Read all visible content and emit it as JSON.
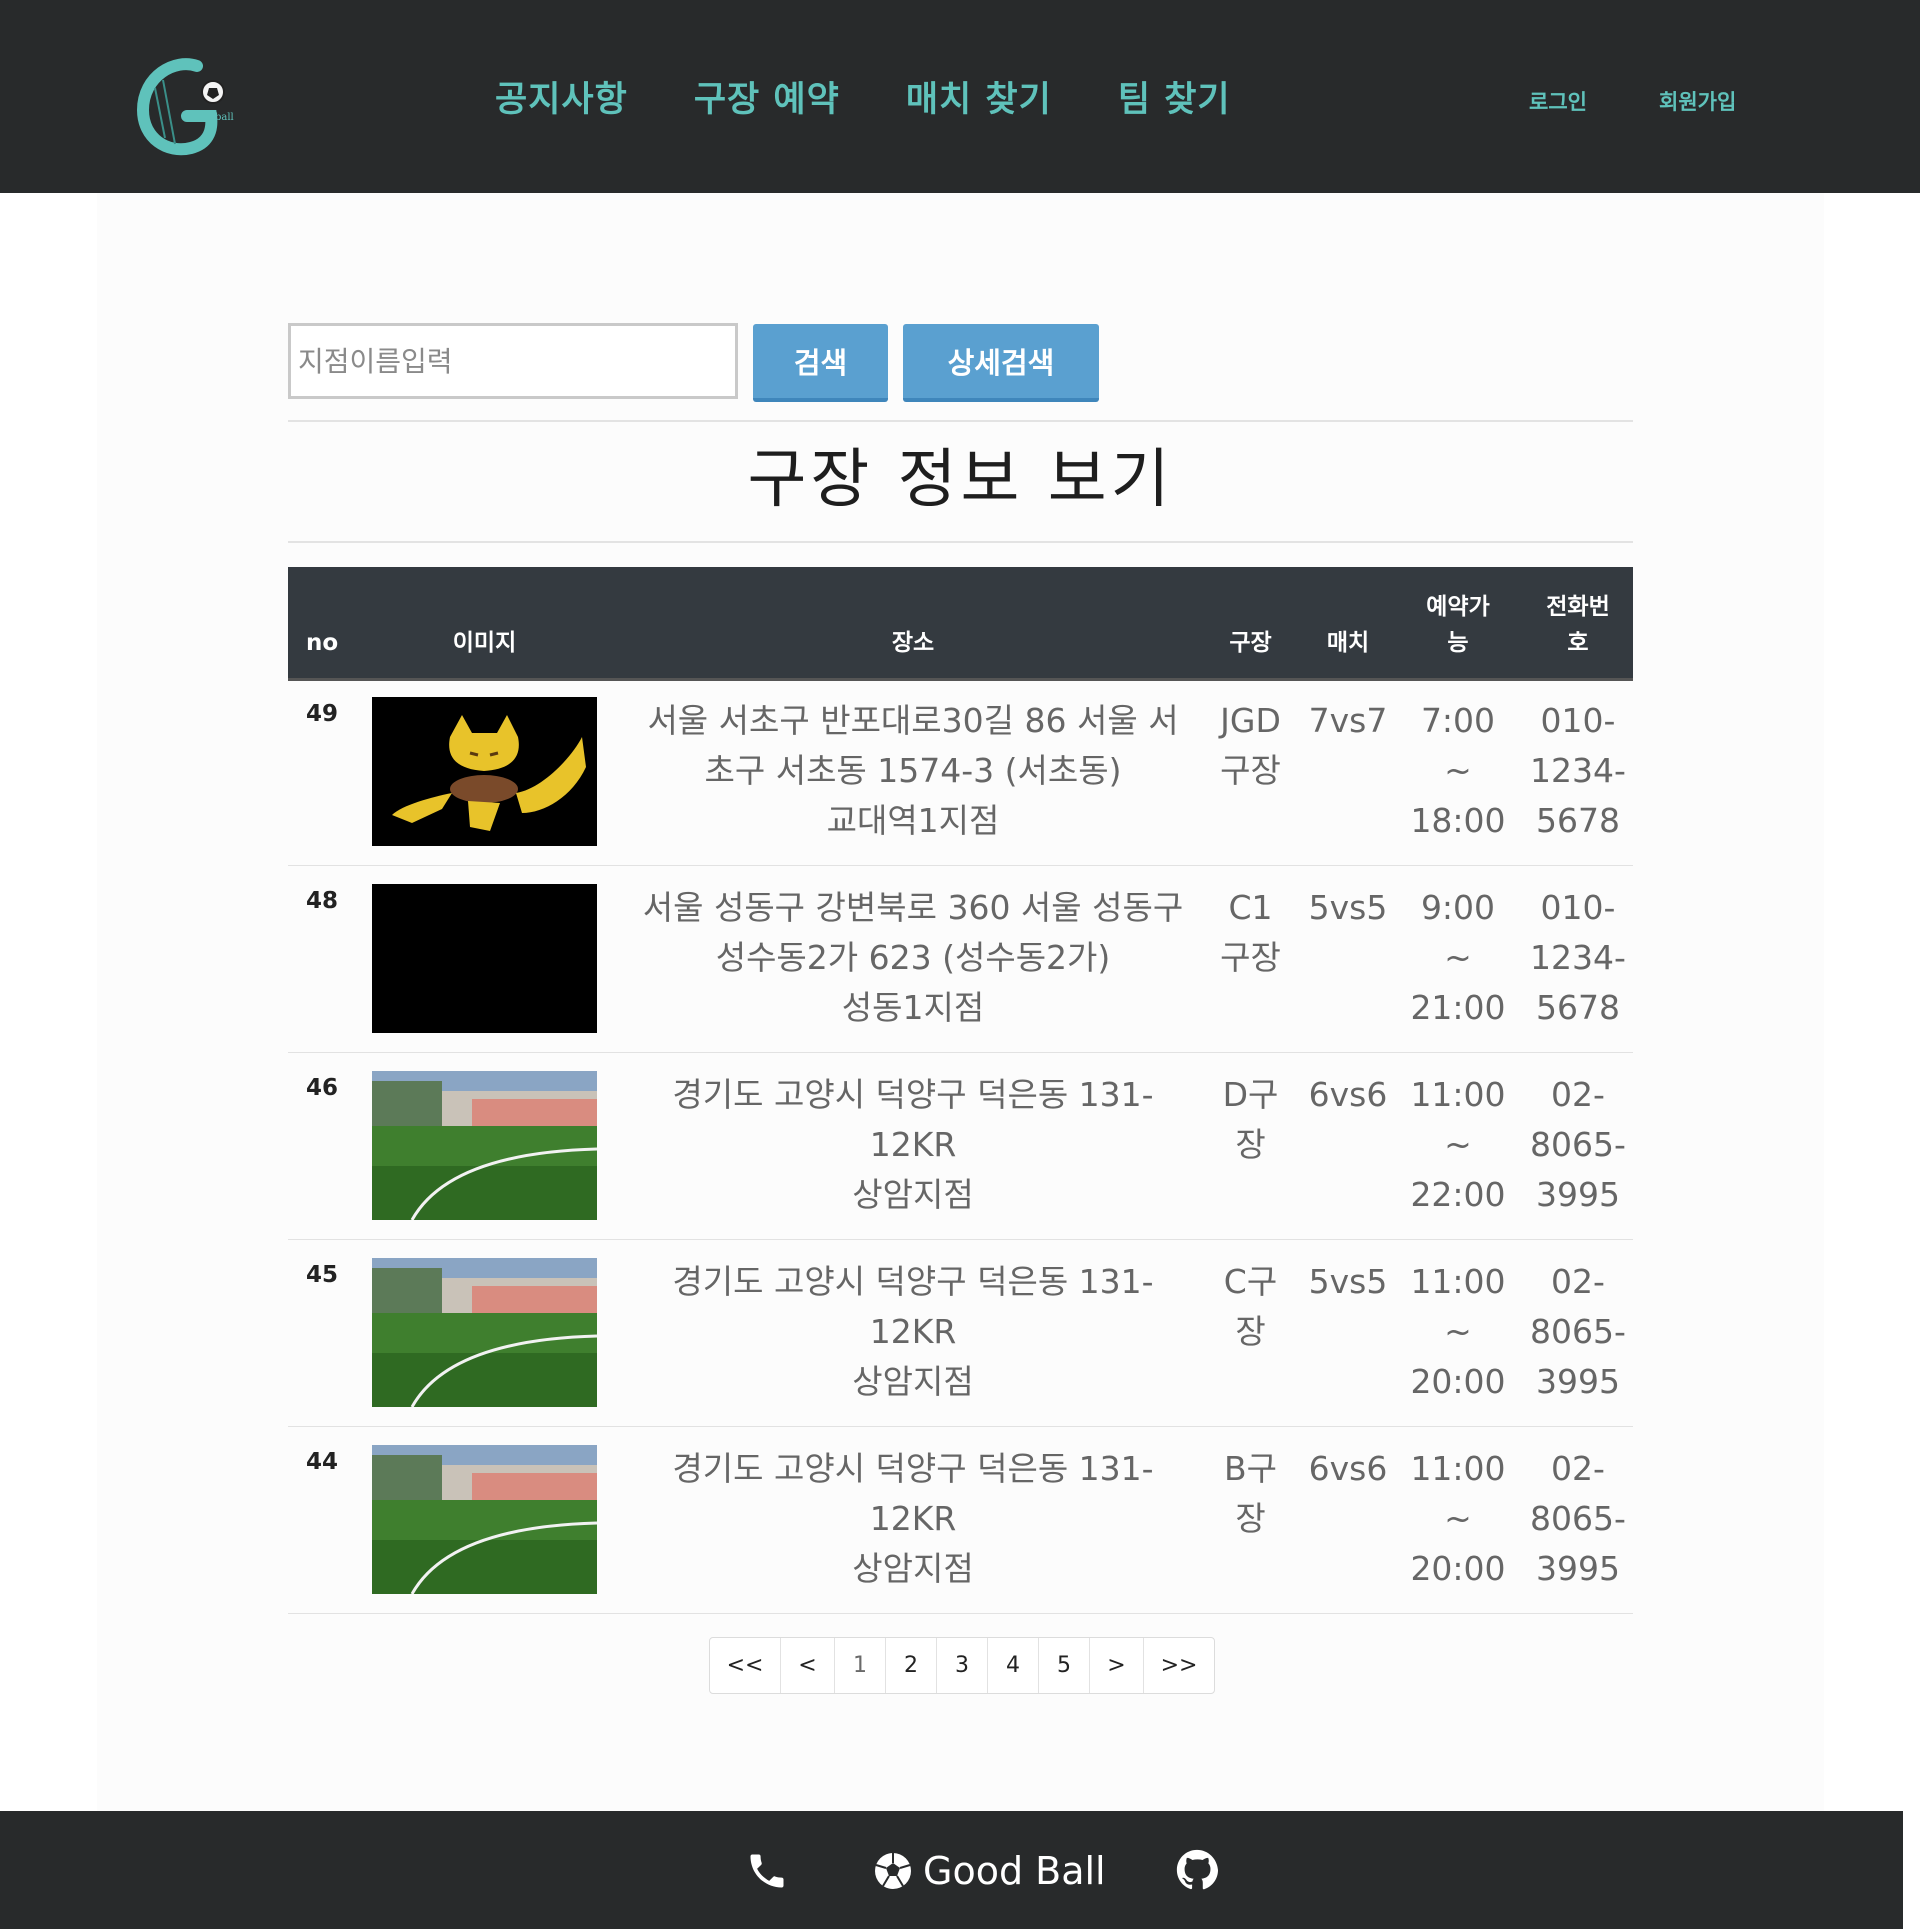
{
  "nav": {
    "items": [
      "공지사항",
      "구장 예약",
      "매치 찾기",
      "팀 찾기"
    ],
    "login": "로그인",
    "signup": "회원가입"
  },
  "search": {
    "placeholder": "지점이름입력",
    "value": "",
    "search_label": "검색",
    "advanced_label": "상세검색"
  },
  "page_title": "구장 정보 보기",
  "table": {
    "headers": [
      "no",
      "이미지",
      "장소",
      "구장",
      "매치",
      "예약가\n능",
      "전화번\n호"
    ],
    "rows": [
      {
        "no": "49",
        "image": "abra",
        "place": "서울 서초구 반포대로30길 86 서울 서초구 서초동 1574-3 (서초동)",
        "branch": "교대역1지점",
        "field": "JGD구장",
        "match": "7vs7",
        "time": "7:00\n~\n18:00",
        "phone": "010-\n1234-\n5678"
      },
      {
        "no": "48",
        "image": "black",
        "place": "서울 성동구 강변북로 360 서울 성동구 성수동2가 623 (성수동2가)",
        "branch": "성동1지점",
        "field": "C1구장",
        "match": "5vs5",
        "time": "9:00\n~\n21:00",
        "phone": "010-\n1234-\n5678"
      },
      {
        "no": "46",
        "image": "turf",
        "place": "경기도 고양시 덕양구 덕은동 131-12KR",
        "branch": "상암지점",
        "field": "D구장",
        "match": "6vs6",
        "time": "11:00\n~\n22:00",
        "phone": "02-\n8065-\n3995"
      },
      {
        "no": "45",
        "image": "turf",
        "place": "경기도 고양시 덕양구 덕은동 131-12KR",
        "branch": "상암지점",
        "field": "C구장",
        "match": "5vs5",
        "time": "11:00\n~\n20:00",
        "phone": "02-\n8065-\n3995"
      },
      {
        "no": "44",
        "image": "turf",
        "place": "경기도 고양시 덕양구 덕은동 131-12KR",
        "branch": "상암지점",
        "field": "B구장",
        "match": "6vs6",
        "time": "11:00\n~\n20:00",
        "phone": "02-\n8065-\n3995"
      }
    ]
  },
  "pagination": {
    "items": [
      "<<",
      "<",
      "1",
      "2",
      "3",
      "4",
      "5",
      ">",
      ">>"
    ],
    "current": "1"
  },
  "footer": {
    "brand": "Good Ball"
  },
  "colors": {
    "header_bg": "#282a2b",
    "nav_accent": "#5fc2bb",
    "button": "#5aa0d0",
    "table_head": "#343a40"
  },
  "icons": [
    "logo-icon",
    "phone-icon",
    "soccer-ball-icon",
    "github-icon"
  ]
}
